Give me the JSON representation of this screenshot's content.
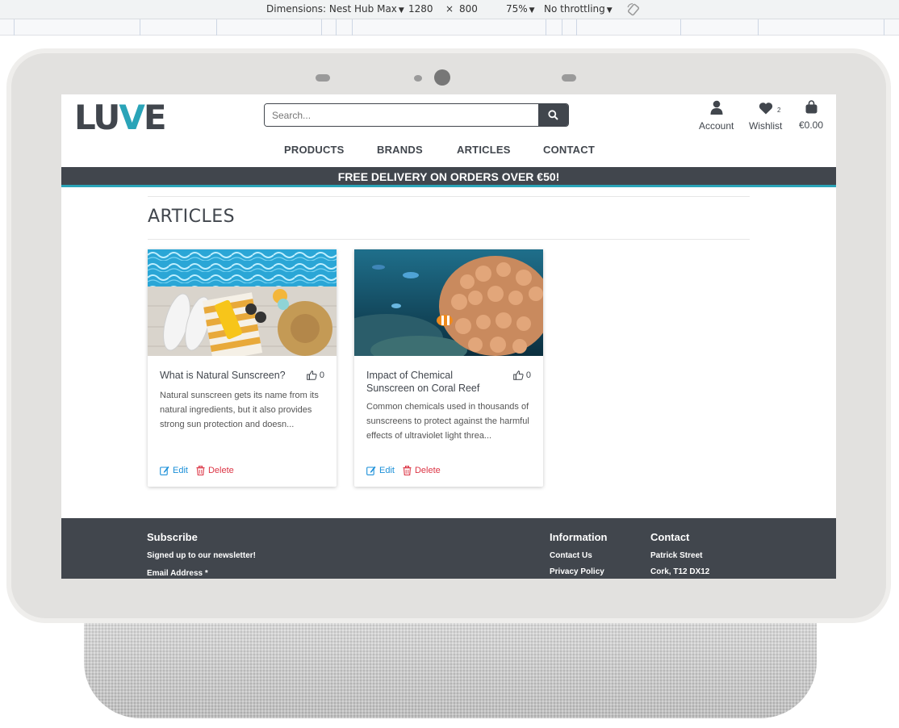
{
  "devtools": {
    "dimensions_label": "Dimensions: Nest Hub Max",
    "width": "1280",
    "times": "×",
    "height": "800",
    "zoom": "75%",
    "throttling": "No throttling"
  },
  "site": {
    "logo_main": "LU",
    "logo_accent": "V",
    "logo_end": "E",
    "search_placeholder": "Search...",
    "account_label": "Account",
    "wishlist_label": "Wishlist",
    "wishlist_count": "2",
    "bag_total": "€0.00",
    "nav": [
      "PRODUCTS",
      "BRANDS",
      "ARTICLES",
      "CONTACT"
    ],
    "banner": "FREE DELIVERY ON ORDERS OVER €50!",
    "page_title": "ARTICLES",
    "accent_color": "#2aa4b8",
    "dark_color": "#41464d"
  },
  "articles": [
    {
      "title": "What is Natural Sunscreen?",
      "likes": "0",
      "excerpt": "Natural sunscreen gets its name from its natural ingredients, but it also provides strong sun protection and doesn...",
      "edit": "Edit",
      "delete": "Delete"
    },
    {
      "title": "Impact of Chemical Sunscreen on Coral Reef",
      "likes": "0",
      "excerpt": "Common chemicals used in thousands of sunscreens to protect against the harmful effects of ultraviolet light threa...",
      "edit": "Edit",
      "delete": "Delete"
    }
  ],
  "footer": {
    "subscribe_heading": "Subscribe",
    "subscribe_text": "Signed up to our newsletter!",
    "email_label": "Email Address *",
    "info_heading": "Information",
    "info_links": [
      "Contact Us",
      "Privacy Policy"
    ],
    "contact_heading": "Contact",
    "contact_lines": [
      "Patrick Street",
      "Cork, T12 DX12"
    ]
  }
}
